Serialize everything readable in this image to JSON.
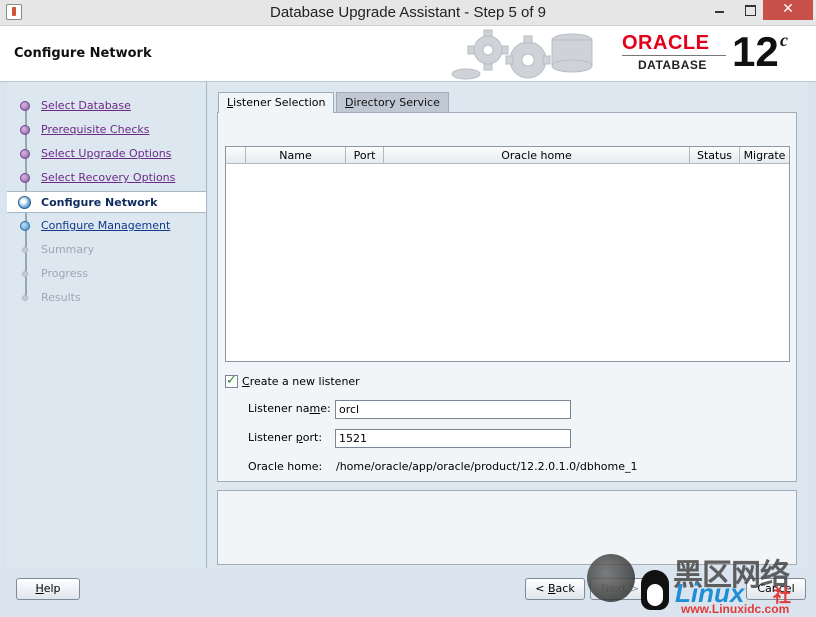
{
  "window": {
    "title": "Database Upgrade Assistant - Step 5 of 9",
    "close_glyph": "✕"
  },
  "header": {
    "heading": "Configure Network",
    "logo": {
      "brand": "ORACLE",
      "product": "DATABASE",
      "version": "12",
      "version_suffix": "c"
    }
  },
  "nav": {
    "steps": [
      {
        "label": "Select Database",
        "state": "done"
      },
      {
        "label": "Prerequisite Checks",
        "state": "done"
      },
      {
        "label": "Select Upgrade Options",
        "state": "done"
      },
      {
        "label": "Select Recovery Options",
        "state": "done"
      },
      {
        "label": "Configure Network",
        "state": "current"
      },
      {
        "label": "Configure Management",
        "state": "next"
      },
      {
        "label": "Summary",
        "state": "future"
      },
      {
        "label": "Progress",
        "state": "future"
      },
      {
        "label": "Results",
        "state": "future"
      }
    ]
  },
  "tabs": {
    "listener_selection": {
      "mnemonic": "L",
      "rest": "istener Selection"
    },
    "directory_service": {
      "mnemonic": "D",
      "rest": "irectory Service"
    }
  },
  "listener_table": {
    "columns": [
      "",
      "Name",
      "Port",
      "Oracle home",
      "Status",
      "Migrate"
    ],
    "rows": []
  },
  "form": {
    "create_listener": {
      "mnemonic": "C",
      "rest": "reate a new listener",
      "checked": true
    },
    "listener_name_label": {
      "before": "Listener na",
      "mnemonic": "m",
      "after": "e:"
    },
    "listener_name_value": "orcl",
    "listener_port_label": {
      "before": "Listener ",
      "mnemonic": "p",
      "after": "ort:"
    },
    "listener_port_value": "1521",
    "oracle_home_label": "Oracle home:",
    "oracle_home_value": "/home/oracle/app/oracle/product/12.2.0.1.0/dbhome_1"
  },
  "buttons": {
    "help": {
      "mnemonic": "H",
      "rest": "elp"
    },
    "back": {
      "prefix": "< ",
      "mnemonic": "B",
      "rest": "ack"
    },
    "next": "Next >",
    "cancel": "Cancel"
  },
  "watermark": {
    "zh": "黑区网络",
    "brand": "Linux",
    "brand_suffix": "社",
    "site": "www.Linuxidc.com"
  }
}
